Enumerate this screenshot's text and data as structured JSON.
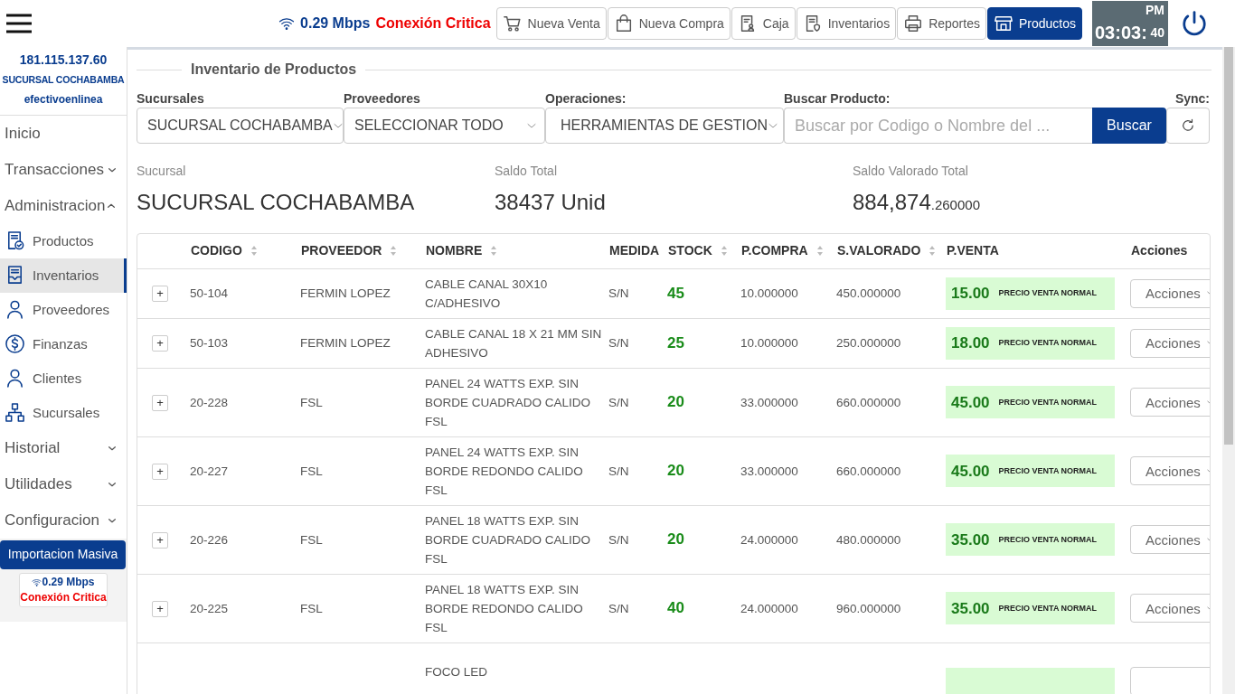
{
  "header": {
    "connection": {
      "speed": "0.29 Mbps",
      "status": "Conexión Critica"
    },
    "nav_buttons": [
      {
        "label": "Nueva Venta",
        "selected": false
      },
      {
        "label": "Nueva Compra",
        "selected": false
      },
      {
        "label": "Caja",
        "selected": false
      },
      {
        "label": "Inventarios",
        "selected": false
      },
      {
        "label": "Reportes",
        "selected": false
      },
      {
        "label": "Productos",
        "selected": true
      }
    ],
    "clock": {
      "period": "PM",
      "time": "03:03:",
      "seconds": "40"
    }
  },
  "sidebar": {
    "ip": "181.115.137.60",
    "branch": "SUCURSAL COCHABAMBA",
    "user": "efectivoenlinea",
    "items": [
      {
        "kind": "link",
        "label": "Inicio"
      },
      {
        "kind": "section",
        "label": "Transacciones",
        "expanded": false
      },
      {
        "kind": "section",
        "label": "Administracion",
        "expanded": true
      },
      {
        "kind": "item",
        "label": "Productos",
        "selected": false
      },
      {
        "kind": "item",
        "label": "Inventarios",
        "selected": true
      },
      {
        "kind": "item",
        "label": "Proveedores",
        "selected": false
      },
      {
        "kind": "item",
        "label": "Finanzas",
        "selected": false
      },
      {
        "kind": "item",
        "label": "Clientes",
        "selected": false
      },
      {
        "kind": "item",
        "label": "Sucursales",
        "selected": false
      },
      {
        "kind": "section",
        "label": "Historial",
        "expanded": false
      },
      {
        "kind": "section",
        "label": "Utilidades",
        "expanded": false
      },
      {
        "kind": "section",
        "label": "Configuracion",
        "expanded": false
      }
    ],
    "import_button": "Importacion Masiva",
    "connection": {
      "speed": "0.29 Mbps",
      "status": "Conexión Critica"
    }
  },
  "main": {
    "title": "Inventario de Productos",
    "filters": {
      "sucursales": {
        "label": "Sucursales",
        "value": "SUCURSAL COCHABAMBA"
      },
      "proveedores": {
        "label": "Proveedores",
        "value": "SELECCIONAR TODO"
      },
      "operaciones": {
        "label": "Operaciones:",
        "value": "HERRAMIENTAS DE GESTION"
      },
      "buscar": {
        "label": "Buscar Producto:",
        "placeholder": "Buscar por Codigo o Nombre del ...",
        "button": "Buscar"
      },
      "sync": {
        "label": "Sync:"
      }
    },
    "summary": {
      "sucursal": {
        "label": "Sucursal",
        "value": "SUCURSAL COCHABAMBA"
      },
      "saldo": {
        "label": "Saldo Total",
        "value": "38437 Unid"
      },
      "valorado": {
        "label": "Saldo Valorado Total",
        "value": "884,874",
        "decimals": ".260000"
      }
    },
    "table": {
      "columns": [
        {
          "label": "CODIGO",
          "sortable": true
        },
        {
          "label": "PROVEEDOR",
          "sortable": true
        },
        {
          "label": "NOMBRE",
          "sortable": true
        },
        {
          "label": "MEDIDA",
          "sortable": false
        },
        {
          "label": "STOCK",
          "sortable": true
        },
        {
          "label": "P.COMPRA",
          "sortable": true
        },
        {
          "label": "S.VALORADO",
          "sortable": true
        },
        {
          "label": "P.VENTA",
          "sortable": false
        },
        {
          "label": "Acciones",
          "sortable": false
        }
      ],
      "rows": [
        {
          "expand": "+",
          "codigo": "50-104",
          "proveedor": "FERMIN LOPEZ",
          "nombre": "CABLE CANAL 30X10 C/ADHESIVO",
          "medida": "S/N",
          "stock": "45",
          "p_compra": "10.000000",
          "s_valorado": "450.000000",
          "p_venta": "15.00",
          "price_type": "PRECIO VENTA NORMAL",
          "action": "Acciones"
        },
        {
          "expand": "+",
          "codigo": "50-103",
          "proveedor": "FERMIN LOPEZ",
          "nombre": "CABLE CANAL 18 X 21 MM SIN ADHESIVO",
          "medida": "S/N",
          "stock": "25",
          "p_compra": "10.000000",
          "s_valorado": "250.000000",
          "p_venta": "18.00",
          "price_type": "PRECIO VENTA NORMAL",
          "action": "Acciones"
        },
        {
          "expand": "+",
          "codigo": "20-228",
          "proveedor": "FSL",
          "nombre": "PANEL 24 WATTS EXP. SIN BORDE CUADRADO CALIDO FSL",
          "medida": "S/N",
          "stock": "20",
          "p_compra": "33.000000",
          "s_valorado": "660.000000",
          "p_venta": "45.00",
          "price_type": "PRECIO VENTA NORMAL",
          "action": "Acciones"
        },
        {
          "expand": "+",
          "codigo": "20-227",
          "proveedor": "FSL",
          "nombre": "PANEL 24 WATTS EXP. SIN BORDE REDONDO CALIDO FSL",
          "medida": "S/N",
          "stock": "20",
          "p_compra": "33.000000",
          "s_valorado": "660.000000",
          "p_venta": "45.00",
          "price_type": "PRECIO VENTA NORMAL",
          "action": "Acciones"
        },
        {
          "expand": "+",
          "codigo": "20-226",
          "proveedor": "FSL",
          "nombre": "PANEL 18 WATTS EXP. SIN BORDE CUADRADO CALIDO FSL",
          "medida": "S/N",
          "stock": "20",
          "p_compra": "24.000000",
          "s_valorado": "480.000000",
          "p_venta": "35.00",
          "price_type": "PRECIO VENTA NORMAL",
          "action": "Acciones"
        },
        {
          "expand": "+",
          "codigo": "20-225",
          "proveedor": "FSL",
          "nombre": "PANEL 18 WATTS EXP. SIN BORDE REDONDO CALIDO FSL",
          "medida": "S/N",
          "stock": "40",
          "p_compra": "24.000000",
          "s_valorado": "960.000000",
          "p_venta": "35.00",
          "price_type": "PRECIO VENTA NORMAL",
          "action": "Acciones"
        },
        {
          "nombre": "FOCO LED"
        }
      ]
    }
  }
}
